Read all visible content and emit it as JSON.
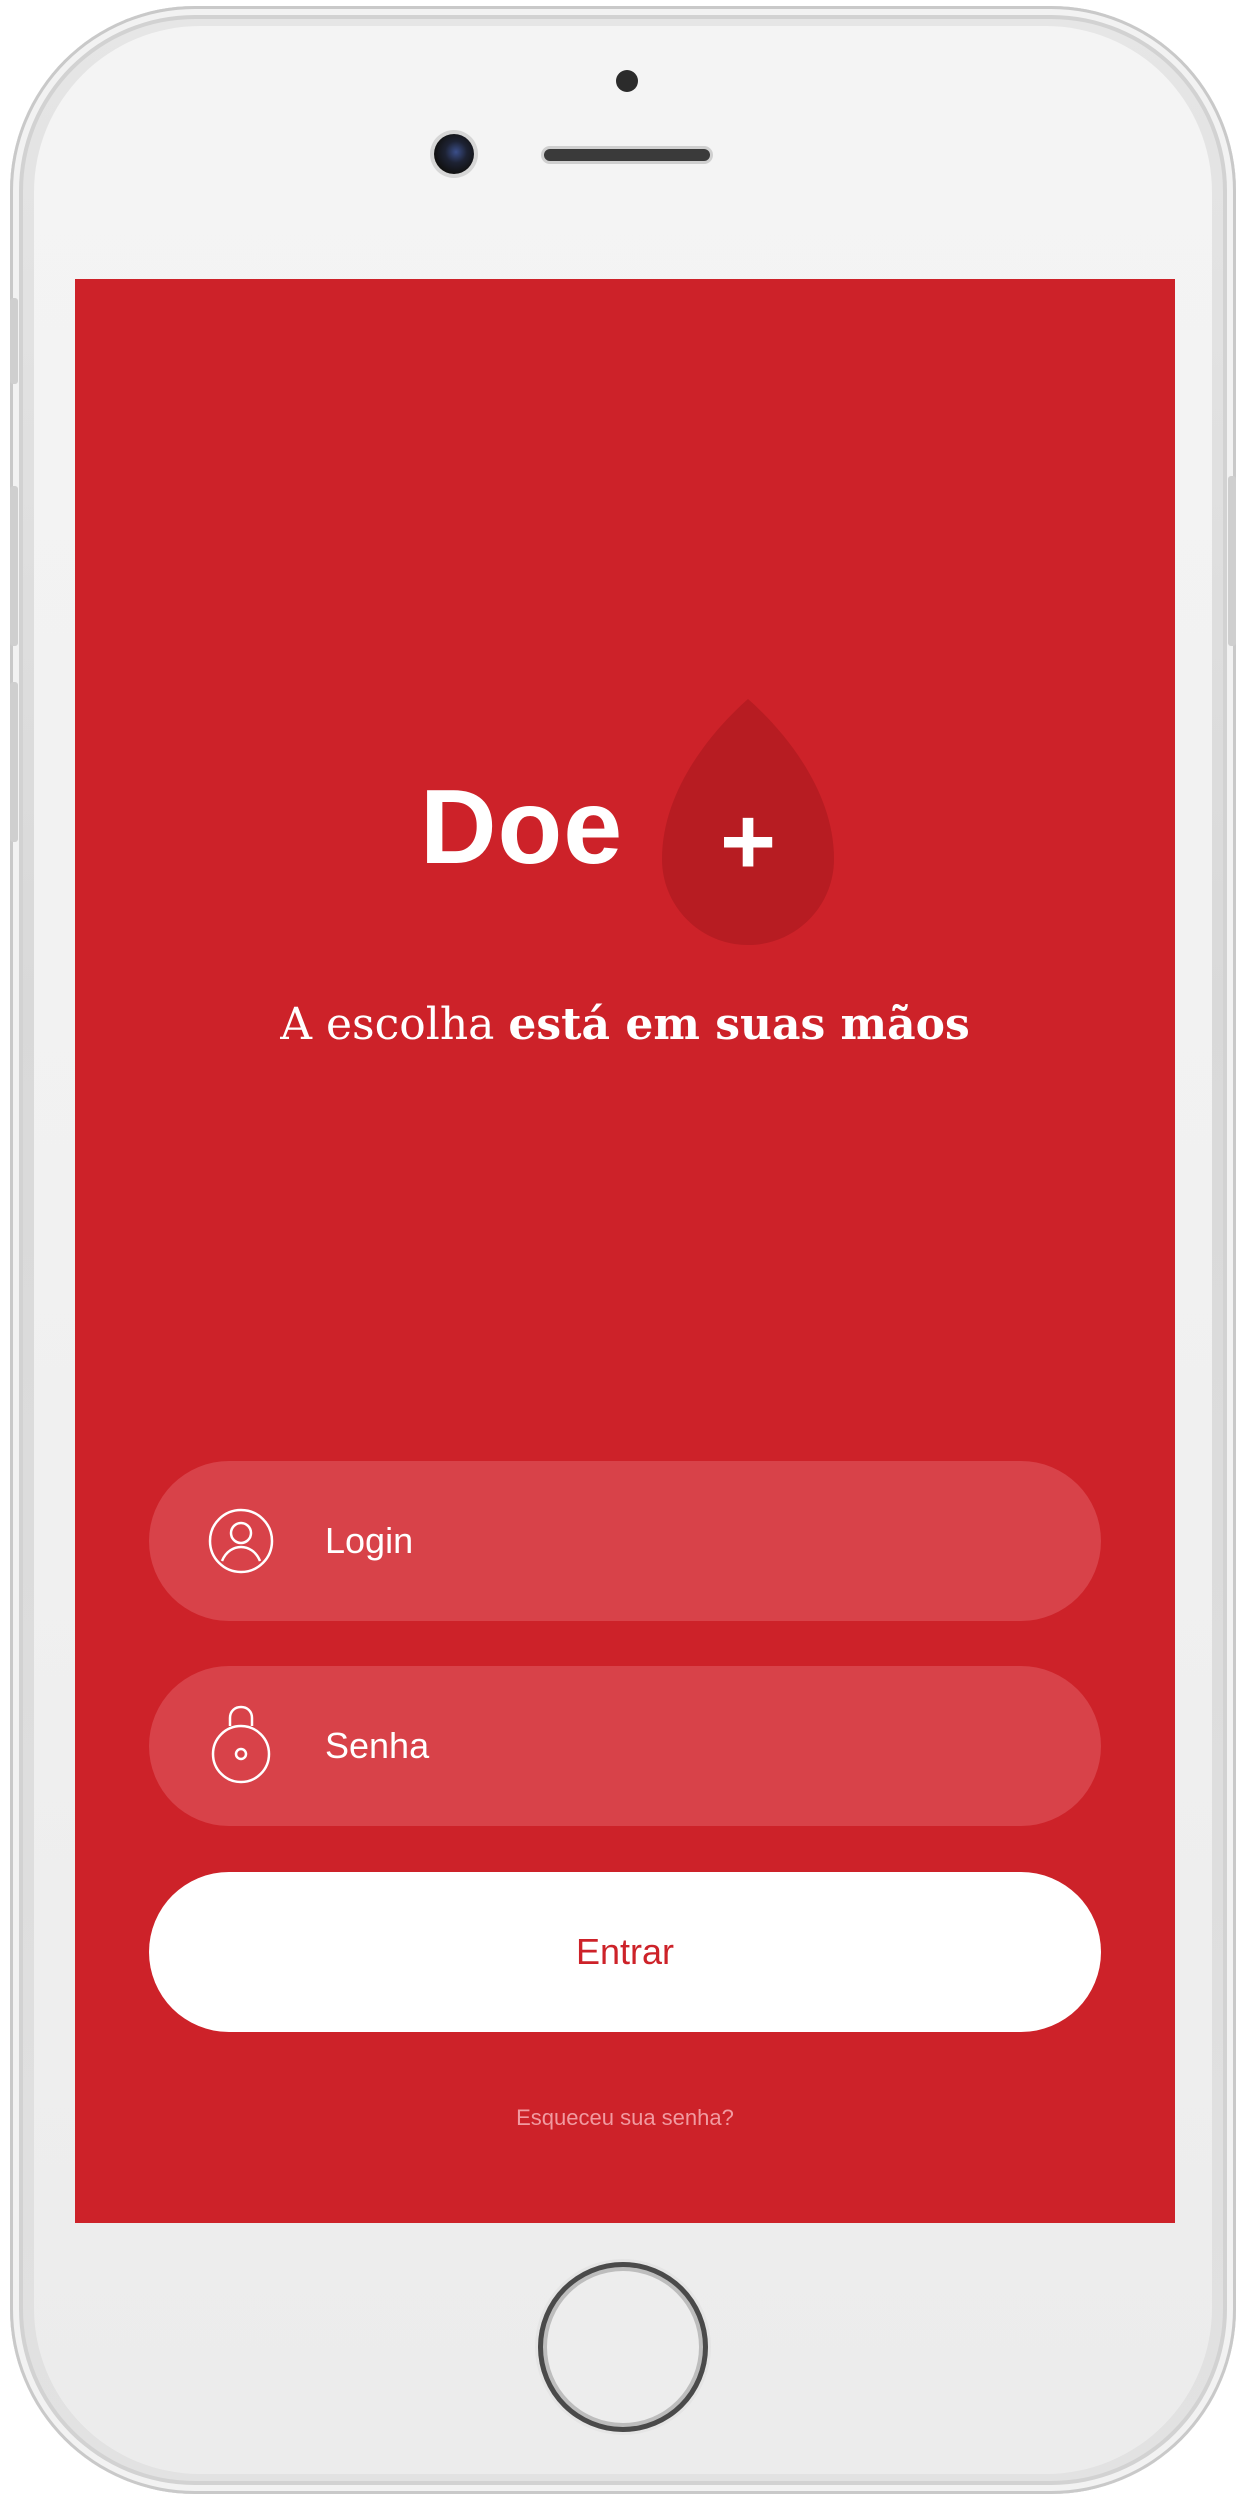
{
  "app": {
    "name": "Doe"
  },
  "logo": {
    "text": "Doe",
    "drop_symbol": "+",
    "drop_color": "#b71c22"
  },
  "tagline": {
    "light": "A escolha ",
    "bold": "está em suas mãos"
  },
  "form": {
    "login": {
      "placeholder": "Login",
      "icon": "user-icon"
    },
    "password": {
      "placeholder": "Senha",
      "icon": "lock-icon"
    },
    "submit_label": "Entrar",
    "forgot_label": "Esqueceu sua senha?"
  },
  "colors": {
    "brand_red": "#cd2229",
    "field_bg": "#d84249",
    "button_bg": "#ffffff",
    "forgot_text": "#f19aa0"
  }
}
